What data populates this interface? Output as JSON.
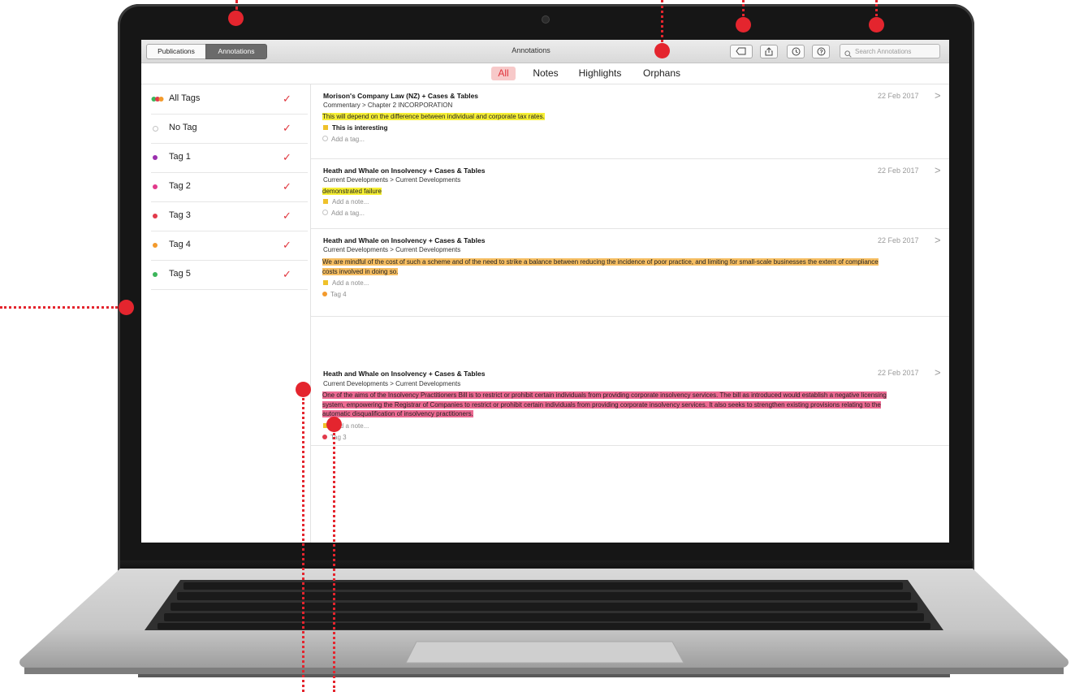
{
  "toolbar": {
    "segments": [
      "Publications",
      "Annotations"
    ],
    "title": "Annotations",
    "search_placeholder": "Search Annotations",
    "icons": [
      "tag-icon",
      "share-icon",
      "history-icon",
      "help-icon",
      "search-icon"
    ]
  },
  "filters": [
    "All",
    "Notes",
    "Highlights",
    "Orphans"
  ],
  "selected_filter": "All",
  "sidebar": {
    "tags": [
      {
        "label": "All Tags",
        "color": "multi",
        "checked": true
      },
      {
        "label": "No Tag",
        "color": "none",
        "checked": true
      },
      {
        "label": "Tag 1",
        "color": "#9b2fae",
        "checked": true
      },
      {
        "label": "Tag 2",
        "color": "#e2398b",
        "checked": true
      },
      {
        "label": "Tag 3",
        "color": "#e23a4b",
        "checked": true
      },
      {
        "label": "Tag 4",
        "color": "#f39a2c",
        "checked": true
      },
      {
        "label": "Tag 5",
        "color": "#3cb55a",
        "checked": true
      }
    ],
    "check_glyph": "✓"
  },
  "annotations": [
    {
      "title": "Morison's Company Law (NZ) + Cases & Tables",
      "path": "Commentary > Chapter 2 INCORPORATION",
      "date": "22 Feb 2017",
      "highlight": "This will depend on the difference between individual and corporate tax rates.",
      "highlight_color": "#f6ef34",
      "note": "This is interesting",
      "tag": "Add a tag..."
    },
    {
      "title": "Heath and Whale on Insolvency + Cases & Tables",
      "path": "Current Developments > Current Developments",
      "date": "22 Feb 2017",
      "highlight": "demonstrated failure",
      "highlight_color": "#f6ef34",
      "note": "Add a note...",
      "tag": "Add a tag..."
    },
    {
      "title": "Heath and Whale on Insolvency + Cases & Tables",
      "path": "Current Developments > Current Developments",
      "date": "22 Feb 2017",
      "highlight_lines": [
        "We are mindful of the cost of such a scheme and of the need to strike a balance between reducing the incidence of poor practice, and limiting for small-scale businesses the extent of compliance",
        "costs involved in doing so."
      ],
      "highlight_color": "#f6be62",
      "note": "Add a note...",
      "tag": "Tag 4"
    },
    {
      "title": "Heath and Whale on Insolvency + Cases & Tables",
      "path": "Current Developments > Current Developments",
      "date": "22 Feb 2017",
      "highlight_lines": [
        "One of the aims of the Insolvency Practitioners Bill is to restrict or prohibit certain individuals from providing corporate insolvency services. The bill as introduced would establish a negative licensing",
        "system, empowering the Registrar of Companies to restrict or prohibit certain individuals from providing corporate insolvency services. It also seeks to strengthen existing provisions relating to the",
        "automatic disqualification of insolvency practitioners."
      ],
      "highlight_color": "#ec6a92",
      "note": "Add a note...",
      "tag": "Tag 3"
    }
  ],
  "chevron_glyph": ">",
  "callout_color": "#e4252e"
}
